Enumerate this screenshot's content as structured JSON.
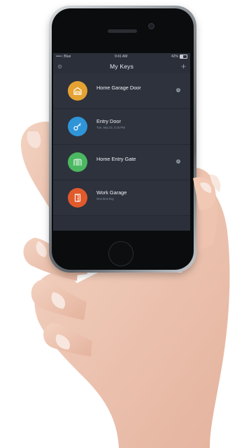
{
  "status_bar": {
    "carrier": "••••○ Blue",
    "time": "9:41 AM",
    "battery": "42%"
  },
  "header": {
    "title": "My Keys"
  },
  "keys": [
    {
      "name": "Home Garage Door",
      "sub": "",
      "color": "#e5a232",
      "icon": "garage-icon",
      "has_info": true
    },
    {
      "name": "Entry Door",
      "sub": "Tue, Sep 22, 3:15 PM",
      "color": "#2f95d8",
      "icon": "key-icon",
      "has_info": false
    },
    {
      "name": "Home Entry Gate",
      "sub": "",
      "color": "#4bb861",
      "icon": "gate-icon",
      "has_info": true
    },
    {
      "name": "Work Garage",
      "sub": "One time key",
      "color": "#e25a2b",
      "icon": "door-icon",
      "has_info": false
    }
  ],
  "colors": {
    "screen_bg": "#2b2f39",
    "text": "#f1f2f5",
    "subtext": "#8e95a2"
  }
}
